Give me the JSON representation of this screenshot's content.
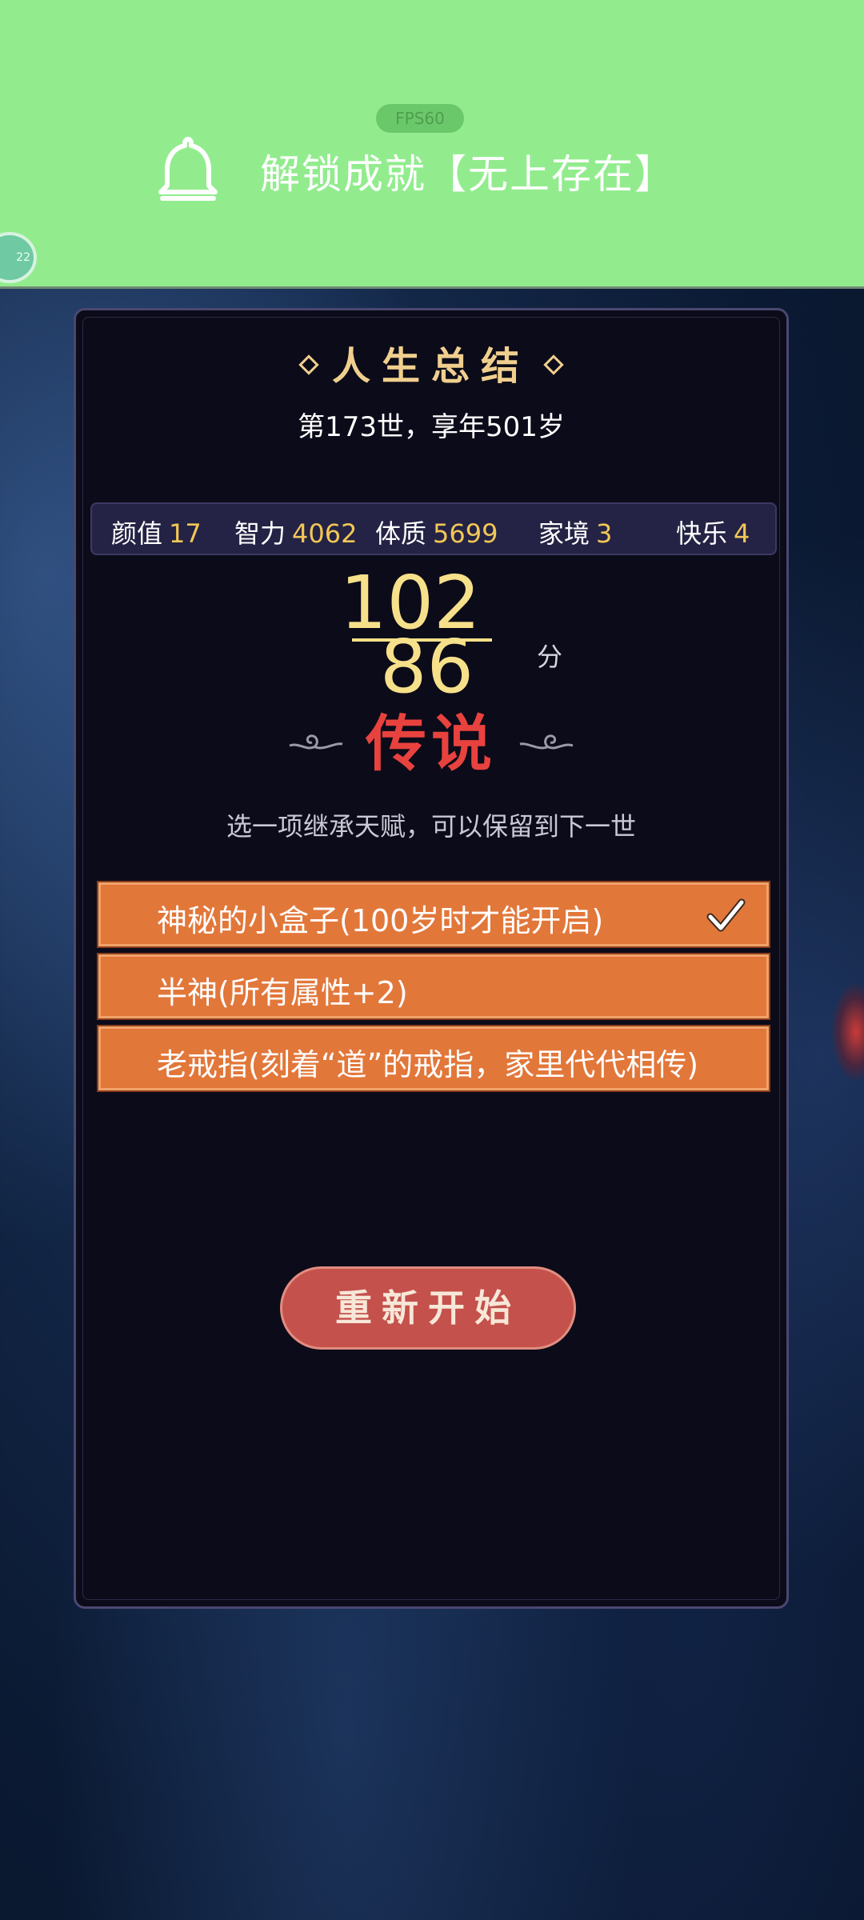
{
  "notification": {
    "fps": "FPS60",
    "message": "解锁成就【无上存在】",
    "side_badge": "22"
  },
  "panel": {
    "title": "人生总结",
    "subtitle": "第173世，享年501岁",
    "stats": [
      {
        "label": "颜值",
        "value": "17"
      },
      {
        "label": "智力",
        "value": "4062"
      },
      {
        "label": "体质",
        "value": "5699"
      },
      {
        "label": "家境",
        "value": "3"
      },
      {
        "label": "快乐",
        "value": "4"
      }
    ],
    "score_top": "102",
    "score_bottom": "86",
    "score_unit": "分",
    "rank": "传说",
    "hint": "选一项继承天赋，可以保留到下一世",
    "options": [
      {
        "label": "神秘的小盒子(100岁时才能开启)",
        "selected": true
      },
      {
        "label": "半神(所有属性+2)",
        "selected": false
      },
      {
        "label": "老戒指(刻着“道”的戒指，家里代代相传)",
        "selected": false
      }
    ],
    "restart_label": "重新开始"
  },
  "colors": {
    "notification_bg": "#92ec8e",
    "panel_bg": "#0c0b19",
    "title": "#f0cf8e",
    "stat_value": "#f2c757",
    "score": "#f7e08a",
    "rank": "#e8423f",
    "option_bg": "#e2773a",
    "restart_bg": "#c4514c"
  },
  "icons": [
    "bell-icon",
    "checkmark-icon",
    "cloud-ornament-icon"
  ]
}
